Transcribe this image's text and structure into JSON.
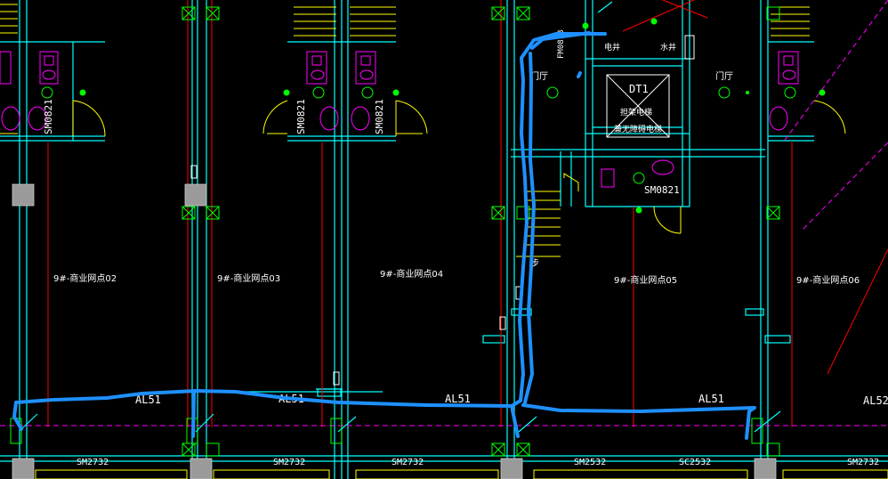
{
  "rooms": [
    "9#-商业网点02",
    "9#-商业网点03",
    "9#-商业网点04",
    "9#-商业网点05",
    "9#-商业网点06"
  ],
  "panels_top": [
    "SM0821",
    "SM0821",
    "SM0821",
    "SM0821"
  ],
  "panels_bottom": [
    "SM2732",
    "SM2732",
    "SM2732",
    "SM2532",
    "SC2532",
    "SM2732"
  ],
  "circuit_labels": [
    "AL51",
    "AL51",
    "AL51",
    "AL51",
    "AL52"
  ],
  "stair_labels": [
    "门厅",
    "门厅"
  ],
  "shaft_labels": {
    "electric": "电井",
    "water": "水井",
    "fm": "FM0818"
  },
  "elevator": {
    "id": "DT1",
    "line1": "担架电梯",
    "line2": "兼无障碍电梯"
  },
  "stair_note": "步",
  "colors": {
    "background": "#000000",
    "wall": "#00ffff",
    "route": "#1e90ff",
    "equipment": "#00ff00",
    "fixture": "#ff00ff",
    "door": "#ffff00",
    "red_line": "#ff0000"
  }
}
